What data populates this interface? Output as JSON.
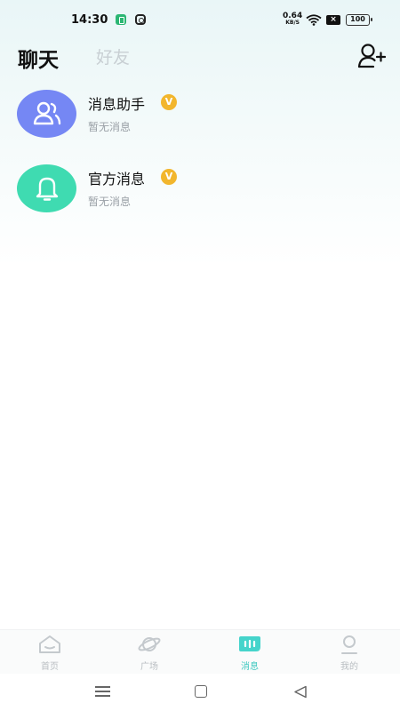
{
  "status_bar": {
    "time": "14:30",
    "net_speed_value": "0.64",
    "net_speed_unit": "KB/S",
    "battery": "100",
    "icons": [
      "battery-saver-icon",
      "instagram-icon",
      "wifi-icon",
      "no-sim-icon",
      "battery-icon"
    ]
  },
  "header": {
    "tabs": [
      {
        "label": "聊天",
        "active": true
      },
      {
        "label": "好友",
        "active": false
      }
    ],
    "add_friend_icon": "add-user-icon"
  },
  "conversations": [
    {
      "name": "消息助手",
      "badge": "V",
      "preview": "暂无消息",
      "icon": "users-icon",
      "color": "#7587f4"
    },
    {
      "name": "官方消息",
      "badge": "V",
      "preview": "暂无消息",
      "icon": "bell-icon",
      "color": "#3fdbb1"
    }
  ],
  "bottom_nav": [
    {
      "label": "首页",
      "icon": "home-icon",
      "active": false
    },
    {
      "label": "广场",
      "icon": "planet-icon",
      "active": false
    },
    {
      "label": "消息",
      "icon": "message-icon",
      "active": true
    },
    {
      "label": "我的",
      "icon": "profile-icon",
      "active": false
    }
  ],
  "colors": {
    "accent": "#3fc9c0",
    "badge": "#f2b62d",
    "inactive": "#b9bec2"
  }
}
